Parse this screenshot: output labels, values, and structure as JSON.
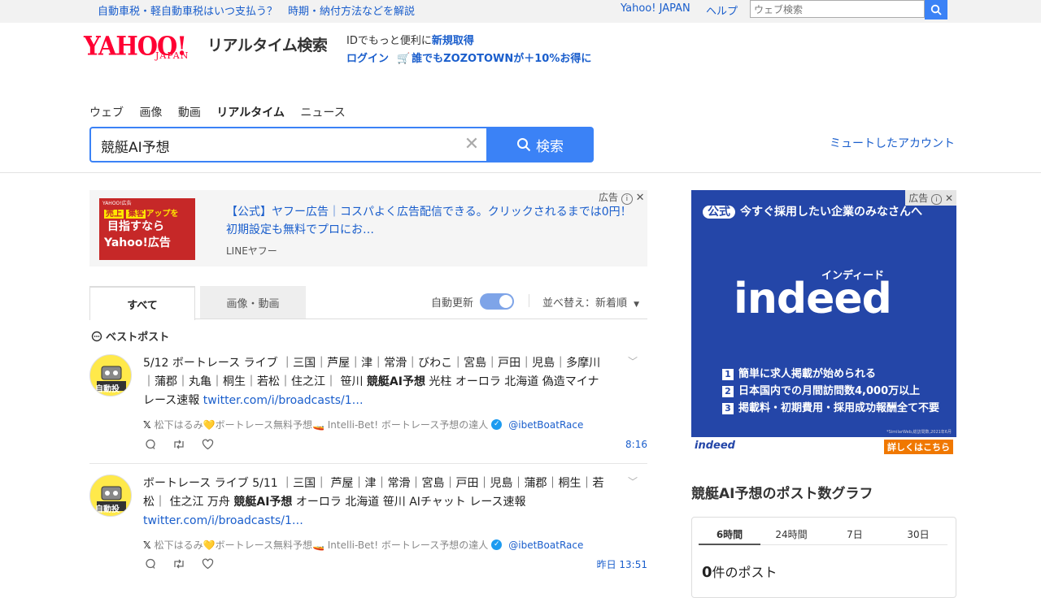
{
  "top": {
    "notice": "自動車税・軽自動車税はいつ支払う？　時期・納付方法などを解説",
    "yahoo_link": "Yahoo! JAPAN",
    "help_link": "ヘルプ",
    "search_placeholder": "ウェブ検索"
  },
  "header": {
    "logo_main": "YAHOO!",
    "logo_sub": "JAPAN",
    "service_name": "リアルタイム検索",
    "promo_line1_prefix": "IDでもっと便利に",
    "promo_line1_link": "新規取得",
    "promo_line2_login": "ログイン",
    "promo_line2_text": "誰でもZOZOTOWNが＋10%お得に"
  },
  "nav": {
    "items": [
      "ウェブ",
      "画像",
      "動画",
      "リアルタイム",
      "ニュース"
    ],
    "active": "リアルタイム"
  },
  "search": {
    "query": "競艇AI予想",
    "button_label": "検索",
    "muted_accounts_link": "ミュートしたアカウント"
  },
  "ad": {
    "image_tiny": "YAHOO!広告",
    "image_line1_a": "売上",
    "image_line1_b": "集客",
    "image_line1_c": "アップを",
    "image_line2": "目指すなら",
    "image_line3": "Yahoo!広告",
    "text": "【公式】ヤフー広告｜コスパよく広告配信できる。クリックされるまでは0円！初期設定も無料でプロにお…",
    "sponsor": "LINEヤフー",
    "label": "広告"
  },
  "tabs": {
    "all": "すべて",
    "media": "画像・動画",
    "auto_update": "自動更新",
    "sort": "並べ替え：新着順"
  },
  "best_posts_label": "ベストポスト",
  "posts": [
    {
      "avatar_text": "自動投",
      "text_before": "5/12 ボートレース ライブ ｜三国｜芦屋｜津｜常滑｜びわこ｜宮島｜戸田｜児島｜多摩川｜蒲郡｜丸亀｜桐生｜若松｜住之江｜ 笹川 ",
      "text_bold": "競艇AI予想",
      "text_after": " 光柱 オーロラ 北海道 偽造マイナ レース速報 ",
      "link": "twitter.com/i/broadcasts/1…",
      "author": "松下はるみ💛ボートレース無料予想🚤 Intelli-Bet! ボートレース予想の達人",
      "handle": "@ibetBoatRace",
      "time": "8:16"
    },
    {
      "avatar_text": "自動投",
      "text_before": "ボートレース ライブ 5/11 ｜三国｜ 芦屋｜津｜常滑｜宮島｜戸田｜児島｜蒲郡｜桐生｜若松｜ 住之江 万舟 ",
      "text_bold": "競艇AI予想",
      "text_after": " オーロラ 北海道 笹川 AIチャット レース速報 ",
      "link": "twitter.com/i/broadcasts/1…",
      "author": "松下はるみ💛ボートレース無料予想🚤 Intelli-Bet! ボートレース予想の達人",
      "handle": "@ibetBoatRace",
      "time": "昨日 13:51"
    }
  ],
  "side_ad": {
    "label": "広告",
    "badge": "公式",
    "headline": "今すぐ採用したい企業のみなさんへ",
    "brand_kana": "インディード",
    "brand": "indeed",
    "points": [
      "簡単に求人掲載が始められる",
      "日本国内での月間訪問数4,000万以上",
      "掲載料・初期費用・採用成功報酬全て不要"
    ],
    "fine_print": "*SimilarWeb,総訪問数,2021年6月",
    "footer_brand": "indeed",
    "cta": "詳しくはこちら"
  },
  "graph": {
    "title": "競艇AI予想のポスト数グラフ",
    "tabs": [
      "6時間",
      "24時間",
      "7日",
      "30日"
    ],
    "count": "0",
    "count_suffix": "件のポスト"
  },
  "colors": {
    "accent": "#3b82f6",
    "link": "#1a5ecc",
    "yahoo_red": "#ff0033",
    "indeed_blue": "#2446a8"
  }
}
